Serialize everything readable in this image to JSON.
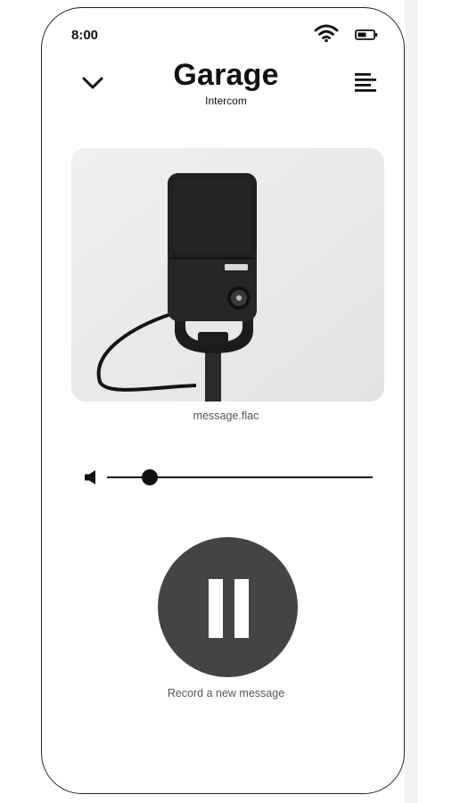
{
  "status_bar": {
    "time": "8:00",
    "icons": [
      "wifi-icon",
      "battery-icon"
    ]
  },
  "header": {
    "collapse_icon": "chevron-down-icon",
    "title": "Garage",
    "subtitle": "Intercom",
    "menu_icon": "menu-icon"
  },
  "media": {
    "image": "microphone-photo",
    "filename": "message.flac"
  },
  "volume": {
    "icon": "speaker-icon",
    "level": 0.16
  },
  "record": {
    "icon": "pause-icon",
    "label": "Record a new message"
  },
  "colors": {
    "accent": "#444444",
    "text": "#111111",
    "muted": "#555555"
  }
}
